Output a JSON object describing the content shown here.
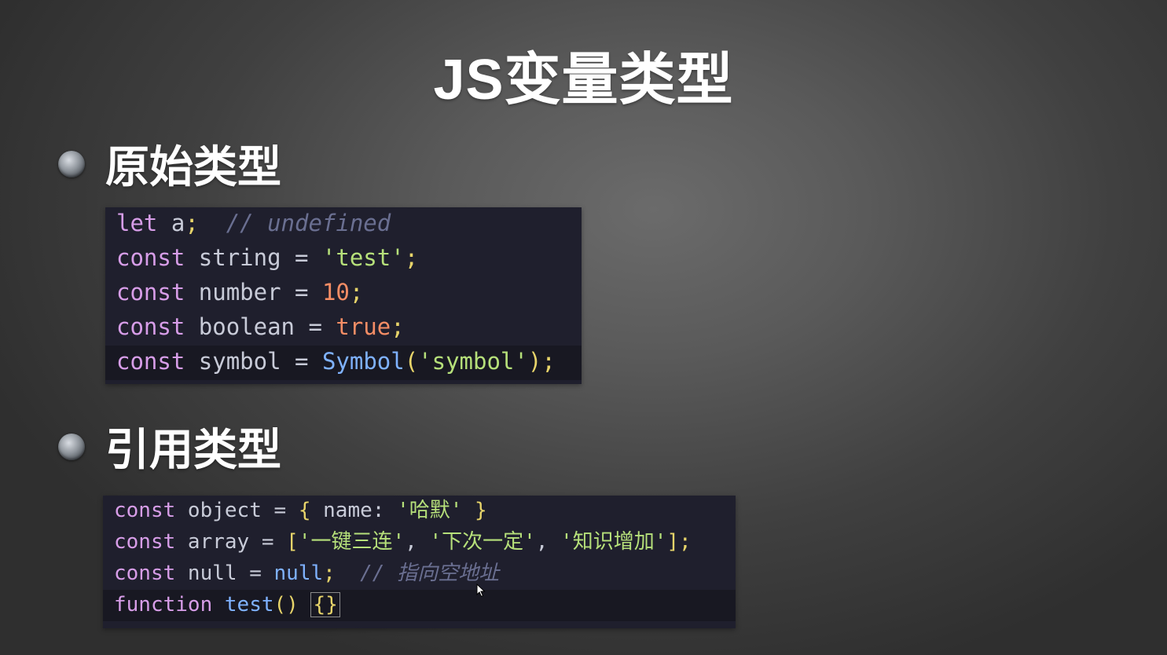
{
  "slide": {
    "title": "JS变量类型"
  },
  "sections": [
    {
      "heading": "原始类型",
      "code": [
        [
          {
            "t": "let",
            "c": "kw"
          },
          {
            "t": " a",
            "c": "ident"
          },
          {
            "t": ";",
            "c": "punc"
          },
          {
            "t": "  ",
            "c": "ident"
          },
          {
            "t": "// undefined",
            "c": "comment"
          }
        ],
        [
          {
            "t": "const",
            "c": "kw"
          },
          {
            "t": " string ",
            "c": "ident"
          },
          {
            "t": "=",
            "c": "op"
          },
          {
            "t": " 'test'",
            "c": "str"
          },
          {
            "t": ";",
            "c": "punc"
          }
        ],
        [
          {
            "t": "const",
            "c": "kw"
          },
          {
            "t": " number ",
            "c": "ident"
          },
          {
            "t": "=",
            "c": "op"
          },
          {
            "t": " ",
            "c": "ident"
          },
          {
            "t": "10",
            "c": "num"
          },
          {
            "t": ";",
            "c": "punc"
          }
        ],
        [
          {
            "t": "const",
            "c": "kw"
          },
          {
            "t": " boolean ",
            "c": "ident"
          },
          {
            "t": "=",
            "c": "op"
          },
          {
            "t": " ",
            "c": "ident"
          },
          {
            "t": "true",
            "c": "bool"
          },
          {
            "t": ";",
            "c": "punc"
          }
        ],
        [
          {
            "t": "const",
            "c": "kw"
          },
          {
            "t": " symbol ",
            "c": "ident"
          },
          {
            "t": "=",
            "c": "op"
          },
          {
            "t": " ",
            "c": "ident"
          },
          {
            "t": "Symbol",
            "c": "fn"
          },
          {
            "t": "(",
            "c": "paren"
          },
          {
            "t": "'symbol'",
            "c": "str"
          },
          {
            "t": ")",
            "c": "paren"
          },
          {
            "t": ";",
            "c": "punc"
          }
        ]
      ],
      "active_line": 4
    },
    {
      "heading": "引用类型",
      "code": [
        [
          {
            "t": "const",
            "c": "kw"
          },
          {
            "t": " object ",
            "c": "ident"
          },
          {
            "t": "=",
            "c": "op"
          },
          {
            "t": " ",
            "c": "ident"
          },
          {
            "t": "{",
            "c": "punc"
          },
          {
            "t": " name: ",
            "c": "ident"
          },
          {
            "t": "'哈默'",
            "c": "str"
          },
          {
            "t": " ",
            "c": "ident"
          },
          {
            "t": "}",
            "c": "punc"
          }
        ],
        [
          {
            "t": "const",
            "c": "kw"
          },
          {
            "t": " array ",
            "c": "ident"
          },
          {
            "t": "=",
            "c": "op"
          },
          {
            "t": " ",
            "c": "ident"
          },
          {
            "t": "[",
            "c": "punc"
          },
          {
            "t": "'一键三连'",
            "c": "str"
          },
          {
            "t": ", ",
            "c": "ident"
          },
          {
            "t": "'下次一定'",
            "c": "str"
          },
          {
            "t": ", ",
            "c": "ident"
          },
          {
            "t": "'知识增加'",
            "c": "str"
          },
          {
            "t": "]",
            "c": "punc"
          },
          {
            "t": ";",
            "c": "punc"
          }
        ],
        [
          {
            "t": "const",
            "c": "kw"
          },
          {
            "t": " null ",
            "c": "ident"
          },
          {
            "t": "=",
            "c": "op"
          },
          {
            "t": " ",
            "c": "ident"
          },
          {
            "t": "null",
            "c": "fn"
          },
          {
            "t": ";",
            "c": "punc"
          },
          {
            "t": "  ",
            "c": "ident"
          },
          {
            "t": "// 指向空地址",
            "c": "comment"
          }
        ],
        [
          {
            "t": "function",
            "c": "kw"
          },
          {
            "t": " ",
            "c": "ident"
          },
          {
            "t": "test",
            "c": "fn"
          },
          {
            "t": "()",
            "c": "paren"
          },
          {
            "t": " ",
            "c": "ident"
          },
          {
            "t": "{}",
            "c": "brace-box"
          }
        ]
      ],
      "active_line": 3
    }
  ],
  "colors": {
    "keyword": "#d79de8",
    "string": "#b6e07a",
    "number": "#f58d65",
    "function": "#7fb2ff",
    "punctuation": "#e7d46a",
    "comment": "#6a6f91",
    "code_background": "#1f1f2d"
  },
  "icons": {
    "bullet": "circle-bullet-icon",
    "cursor": "mouse-pointer-icon"
  }
}
